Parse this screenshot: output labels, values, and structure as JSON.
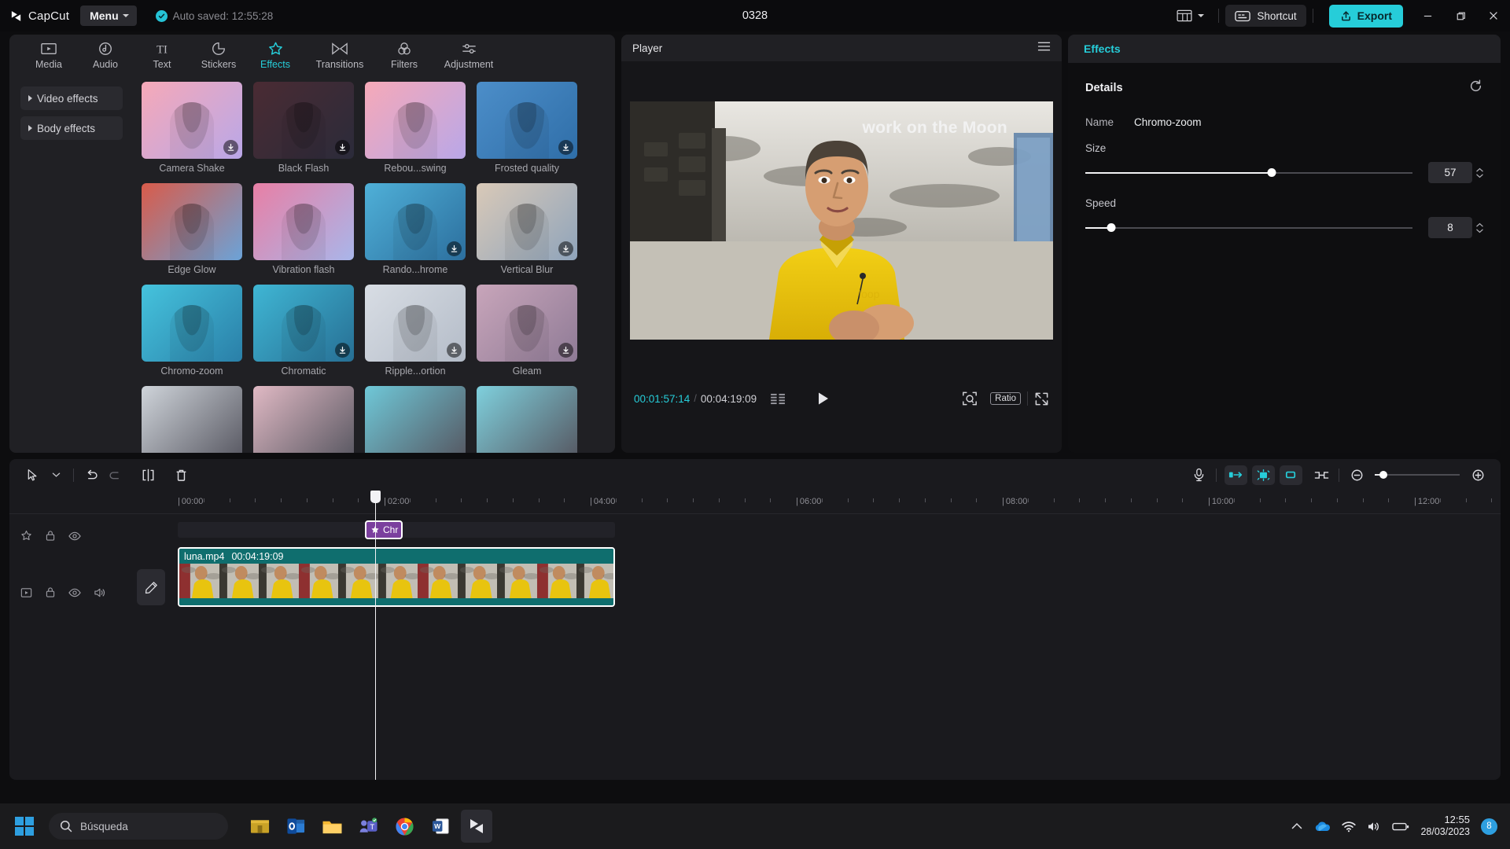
{
  "titlebar": {
    "brand": "CapCut",
    "menu_label": "Menu",
    "autosave_text": "Auto saved: 12:55:28",
    "project_title": "0328",
    "layout_icon": "layout-grid-icon",
    "shortcut_label": "Shortcut",
    "export_label": "Export",
    "minimize_icon": "minimize-icon",
    "maximize_icon": "maximize-icon",
    "close_icon": "close-icon",
    "accent": "#26cdd9"
  },
  "left_panel": {
    "tabs": [
      {
        "label": "Media",
        "icon": "media-icon",
        "active": false
      },
      {
        "label": "Audio",
        "icon": "audio-icon",
        "active": false
      },
      {
        "label": "Text",
        "icon": "text-icon",
        "active": false
      },
      {
        "label": "Stickers",
        "icon": "stickers-icon",
        "active": false
      },
      {
        "label": "Effects",
        "icon": "effects-icon",
        "active": true
      },
      {
        "label": "Transitions",
        "icon": "transitions-icon",
        "active": false
      },
      {
        "label": "Filters",
        "icon": "filters-icon",
        "active": false
      },
      {
        "label": "Adjustment",
        "icon": "adjustment-icon",
        "active": false
      }
    ],
    "categories": [
      {
        "label": "Video effects"
      },
      {
        "label": "Body effects"
      }
    ],
    "effects": [
      {
        "label": "Camera Shake",
        "download": true,
        "selected": false,
        "thumb": "girl-pink"
      },
      {
        "label": "Black Flash",
        "download": true,
        "selected": false,
        "thumb": "girl-dark"
      },
      {
        "label": "Rebou...swing",
        "download": false,
        "selected": false,
        "thumb": "girl-pink"
      },
      {
        "label": "Frosted quality",
        "download": true,
        "selected": false,
        "thumb": "skater"
      },
      {
        "label": "Edge Glow",
        "download": false,
        "selected": false,
        "thumb": "man-red"
      },
      {
        "label": "Vibration flash",
        "download": false,
        "selected": false,
        "thumb": "girl-blur"
      },
      {
        "label": "Rando...hrome",
        "download": true,
        "selected": false,
        "thumb": "girl-blue"
      },
      {
        "label": "Vertical Blur",
        "download": true,
        "selected": false,
        "thumb": "city"
      },
      {
        "label": "Chromo-zoom",
        "download": false,
        "selected": false,
        "thumb": "man-chroma"
      },
      {
        "label": "Chromatic",
        "download": true,
        "selected": false,
        "thumb": "man-chroma2"
      },
      {
        "label": "Ripple...ortion",
        "download": true,
        "selected": false,
        "thumb": "woman-white"
      },
      {
        "label": "Gleam",
        "download": true,
        "selected": false,
        "thumb": "portrait"
      }
    ]
  },
  "player": {
    "panel_title": "Player",
    "menu_icon": "hamburger-icon",
    "overlay_text": "work on the Moon",
    "current_time": "00:01:57:14",
    "total_time": "00:04:19:09",
    "separator": "/",
    "list_icon": "list-icon",
    "play_icon": "play-icon",
    "snapshot_icon": "snapshot-icon",
    "ratio_label": "Ratio",
    "fullscreen_icon": "fullscreen-icon"
  },
  "right_panel": {
    "header": "Effects",
    "details_title": "Details",
    "reset_icon": "reset-icon",
    "name_label": "Name",
    "name_value": "Chromo-zoom",
    "sliders": [
      {
        "label": "Size",
        "value": "57",
        "percent": 57
      },
      {
        "label": "Speed",
        "value": "8",
        "percent": 8
      }
    ]
  },
  "timeline": {
    "toolbar": {
      "select_icon": "cursor-select-icon",
      "dropdown_icon": "chevron-down-icon",
      "undo_icon": "undo-icon",
      "redo_icon": "redo-icon",
      "split_icon": "split-icon",
      "delete_icon": "trash-icon",
      "mic_icon": "microphone-icon",
      "keyframe_prev_icon": "keyframe-prev-icon",
      "keyframe_add_icon": "keyframe-add-icon",
      "keyframe_next_icon": "keyframe-next-icon",
      "mirror_icon": "mirror-split-icon",
      "zoom_out_icon": "zoom-out-icon",
      "zoom_in_icon": "zoom-in-icon",
      "zoom_percent": 10
    },
    "ruler_ticks": [
      "00:00",
      "02:00",
      "04:00",
      "06:00",
      "08:00",
      "10:00",
      "12:00"
    ],
    "playhead_time": "02:00",
    "fx_track": {
      "gutter_icons": [
        "effect-track-icon",
        "lock-icon",
        "eye-icon"
      ],
      "clip_label": "Chr",
      "clip_icon": "effect-star-icon"
    },
    "video_track": {
      "gutter_icons": [
        "video-track-icon",
        "lock-icon",
        "eye-icon",
        "speaker-icon"
      ],
      "edit_icon": "pencil-edit-icon",
      "clip_name": "luna.mp4",
      "clip_duration": "00:04:19:09"
    }
  },
  "taskbar": {
    "start_icon": "windows-start-icon",
    "search_icon": "search-icon",
    "search_placeholder": "Búsqueda",
    "apps": [
      {
        "name": "store-icon",
        "active": false
      },
      {
        "name": "outlook-icon",
        "active": false
      },
      {
        "name": "explorer-icon",
        "active": false
      },
      {
        "name": "teams-icon",
        "active": false
      },
      {
        "name": "chrome-icon",
        "active": false
      },
      {
        "name": "word-icon",
        "active": false
      },
      {
        "name": "capcut-icon",
        "active": true
      }
    ],
    "tray": {
      "chevron_icon": "chevron-up-icon",
      "onedrive_icon": "onedrive-icon",
      "wifi_icon": "wifi-icon",
      "volume_icon": "volume-icon",
      "battery_icon": "battery-icon"
    },
    "clock_time": "12:55",
    "clock_date": "28/03/2023",
    "notification_count": "8"
  }
}
